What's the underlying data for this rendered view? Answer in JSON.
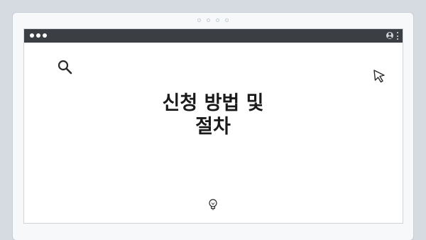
{
  "hero": {
    "title_line1": "신청 방법 및",
    "title_line2": "절차"
  },
  "icons": {
    "search": "search-icon",
    "cursor": "cursor-arrow-icon",
    "bulb": "lightbulb-icon",
    "profile": "profile-icon",
    "menu": "kebab-menu-icon"
  },
  "colors": {
    "background": "#d6dbe1",
    "titlebar": "#3b3f44",
    "canvas": "#ffffff",
    "text": "#1a1a1a"
  }
}
